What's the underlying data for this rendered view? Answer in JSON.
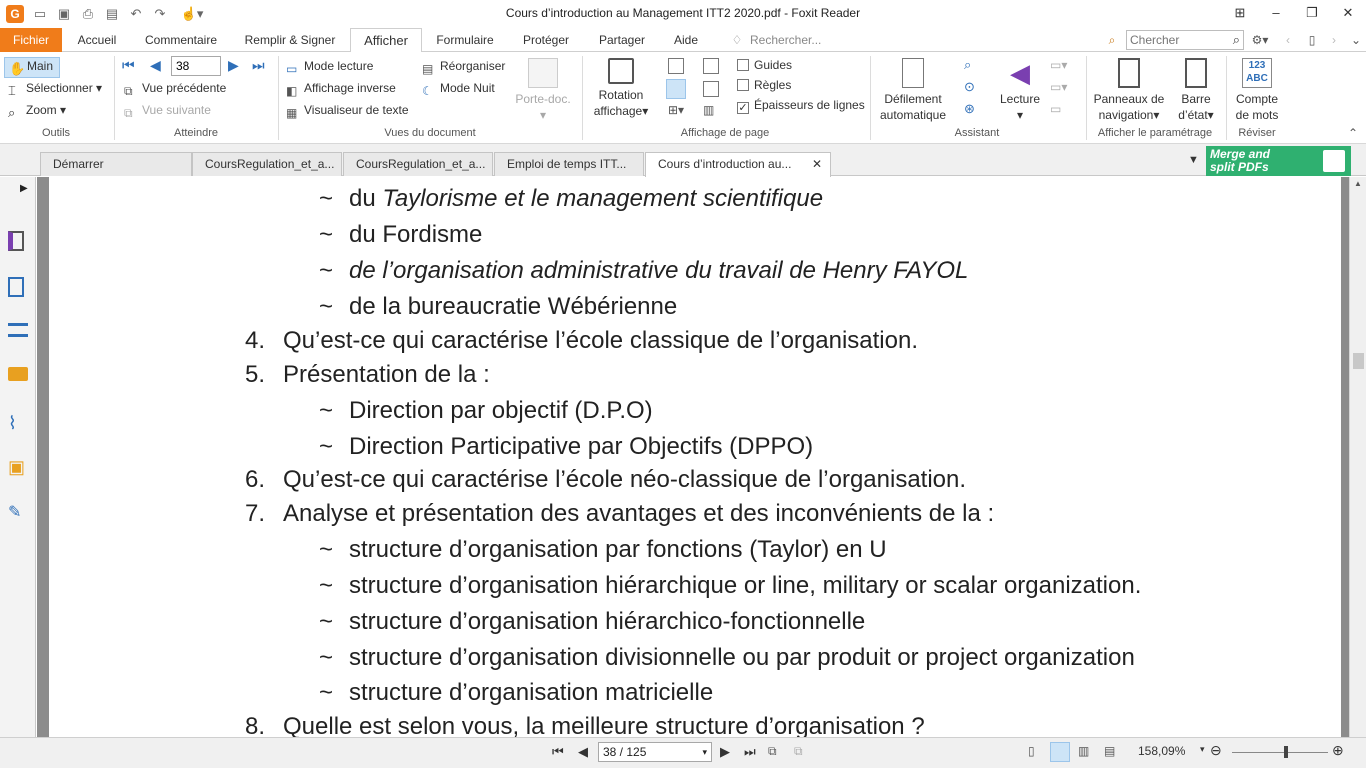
{
  "app": {
    "title": "Cours d’introduction au Management  ITT2 2020.pdf - Foxit Reader"
  },
  "menubar": {
    "items": [
      "Fichier",
      "Accueil",
      "Commentaire",
      "Remplir & Signer",
      "Afficher",
      "Formulaire",
      "Protéger",
      "Partager",
      "Aide"
    ],
    "search_hint": "Rechercher...",
    "search_placeholder": "Chercher"
  },
  "ribbon": {
    "tools": {
      "main": "Main",
      "select": "Sélectionner",
      "zoom": "Zoom",
      "label": "Outils"
    },
    "goto": {
      "page_value": "38",
      "prev_view": "Vue précédente",
      "next_view": "Vue suivante",
      "label": "Atteindre"
    },
    "docviews": {
      "read": "Mode lecture",
      "reorganize": "Réorganiser",
      "inverse": "Affichage inverse",
      "night": "Mode Nuit",
      "textviewer": "Visualiseur de texte",
      "portedoc": "Porte-doc.",
      "label": "Vues du document"
    },
    "pagedisplay": {
      "rotation1": "Rotation",
      "rotation2": "affichage",
      "guides": "Guides",
      "rules": "Règles",
      "lineweights": "Épaisseurs de lignes",
      "label": "Affichage de page"
    },
    "assistant": {
      "scroll1": "Défilement",
      "scroll2": "automatique",
      "read": "Lecture",
      "label": "Assistant"
    },
    "panels": {
      "nav1": "Panneaux de",
      "nav2": "navigation",
      "status1": "Barre",
      "status2": "d’état",
      "label": "Afficher le paramétrage"
    },
    "review": {
      "count1": "Compte",
      "count2": "de mots",
      "icon_text": "123 ABC",
      "label": "Réviser"
    }
  },
  "tabs": [
    {
      "label": "Démarrer"
    },
    {
      "label": "CoursRegulation_et_a..."
    },
    {
      "label": "CoursRegulation_et_a..."
    },
    {
      "label": "Emploi de temps ITT..."
    },
    {
      "label": "Cours d’introduction au..."
    }
  ],
  "ad": {
    "line1": "Merge and",
    "line2": "split PDFs"
  },
  "document": {
    "lines": [
      {
        "kind": "tilde",
        "prefix": "du ",
        "text": "Taylorisme et le management scientifique",
        "italic": true
      },
      {
        "kind": "tilde",
        "prefix": "",
        "text": "du Fordisme",
        "italic": false
      },
      {
        "kind": "tilde",
        "prefix": "",
        "text": "de l’organisation administrative du travail de Henry FAYOL",
        "italic": true
      },
      {
        "kind": "tilde",
        "prefix": "",
        "text": "de la bureaucratie Wébérienne",
        "italic": false
      },
      {
        "kind": "num",
        "num": "4.",
        "text": "Qu’est-ce qui caractérise l’école classique de l’organisation."
      },
      {
        "kind": "num",
        "num": "5.",
        "text": "Présentation de la :"
      },
      {
        "kind": "tilde",
        "prefix": "",
        "text": "Direction par objectif (D.P.O)",
        "italic": false
      },
      {
        "kind": "tilde",
        "prefix": "",
        "text": "Direction Participative par Objectifs (DPPO)",
        "italic": false
      },
      {
        "kind": "num",
        "num": "6.",
        "text": "Qu’est-ce qui caractérise l’école néo-classique de l’organisation."
      },
      {
        "kind": "num",
        "num": "7.",
        "text": "Analyse et présentation des avantages et des inconvénients de la :"
      },
      {
        "kind": "tilde",
        "prefix": "",
        "text": "structure d’organisation par fonctions (Taylor) en U",
        "italic": false
      },
      {
        "kind": "tilde",
        "prefix": "",
        "text": "structure d’organisation hiérarchique or line, military or scalar organization.",
        "italic": false
      },
      {
        "kind": "tilde",
        "prefix": "",
        "text": "structure d’organisation hiérarchico-fonctionnelle",
        "italic": false
      },
      {
        "kind": "tilde",
        "prefix": "",
        "text": "structure d’organisation divisionnelle ou par produit or project organization",
        "italic": false
      },
      {
        "kind": "tilde",
        "prefix": "",
        "text": "structure d’organisation matricielle",
        "italic": false
      },
      {
        "kind": "num",
        "num": "8.",
        "text": "Quelle est selon vous, la meilleure structure d’organisation ?"
      }
    ]
  },
  "statusbar": {
    "page": "38 / 125",
    "zoom": "158,09%"
  },
  "colors": {
    "accent": "#f07c1a",
    "ad": "#2fb070"
  }
}
